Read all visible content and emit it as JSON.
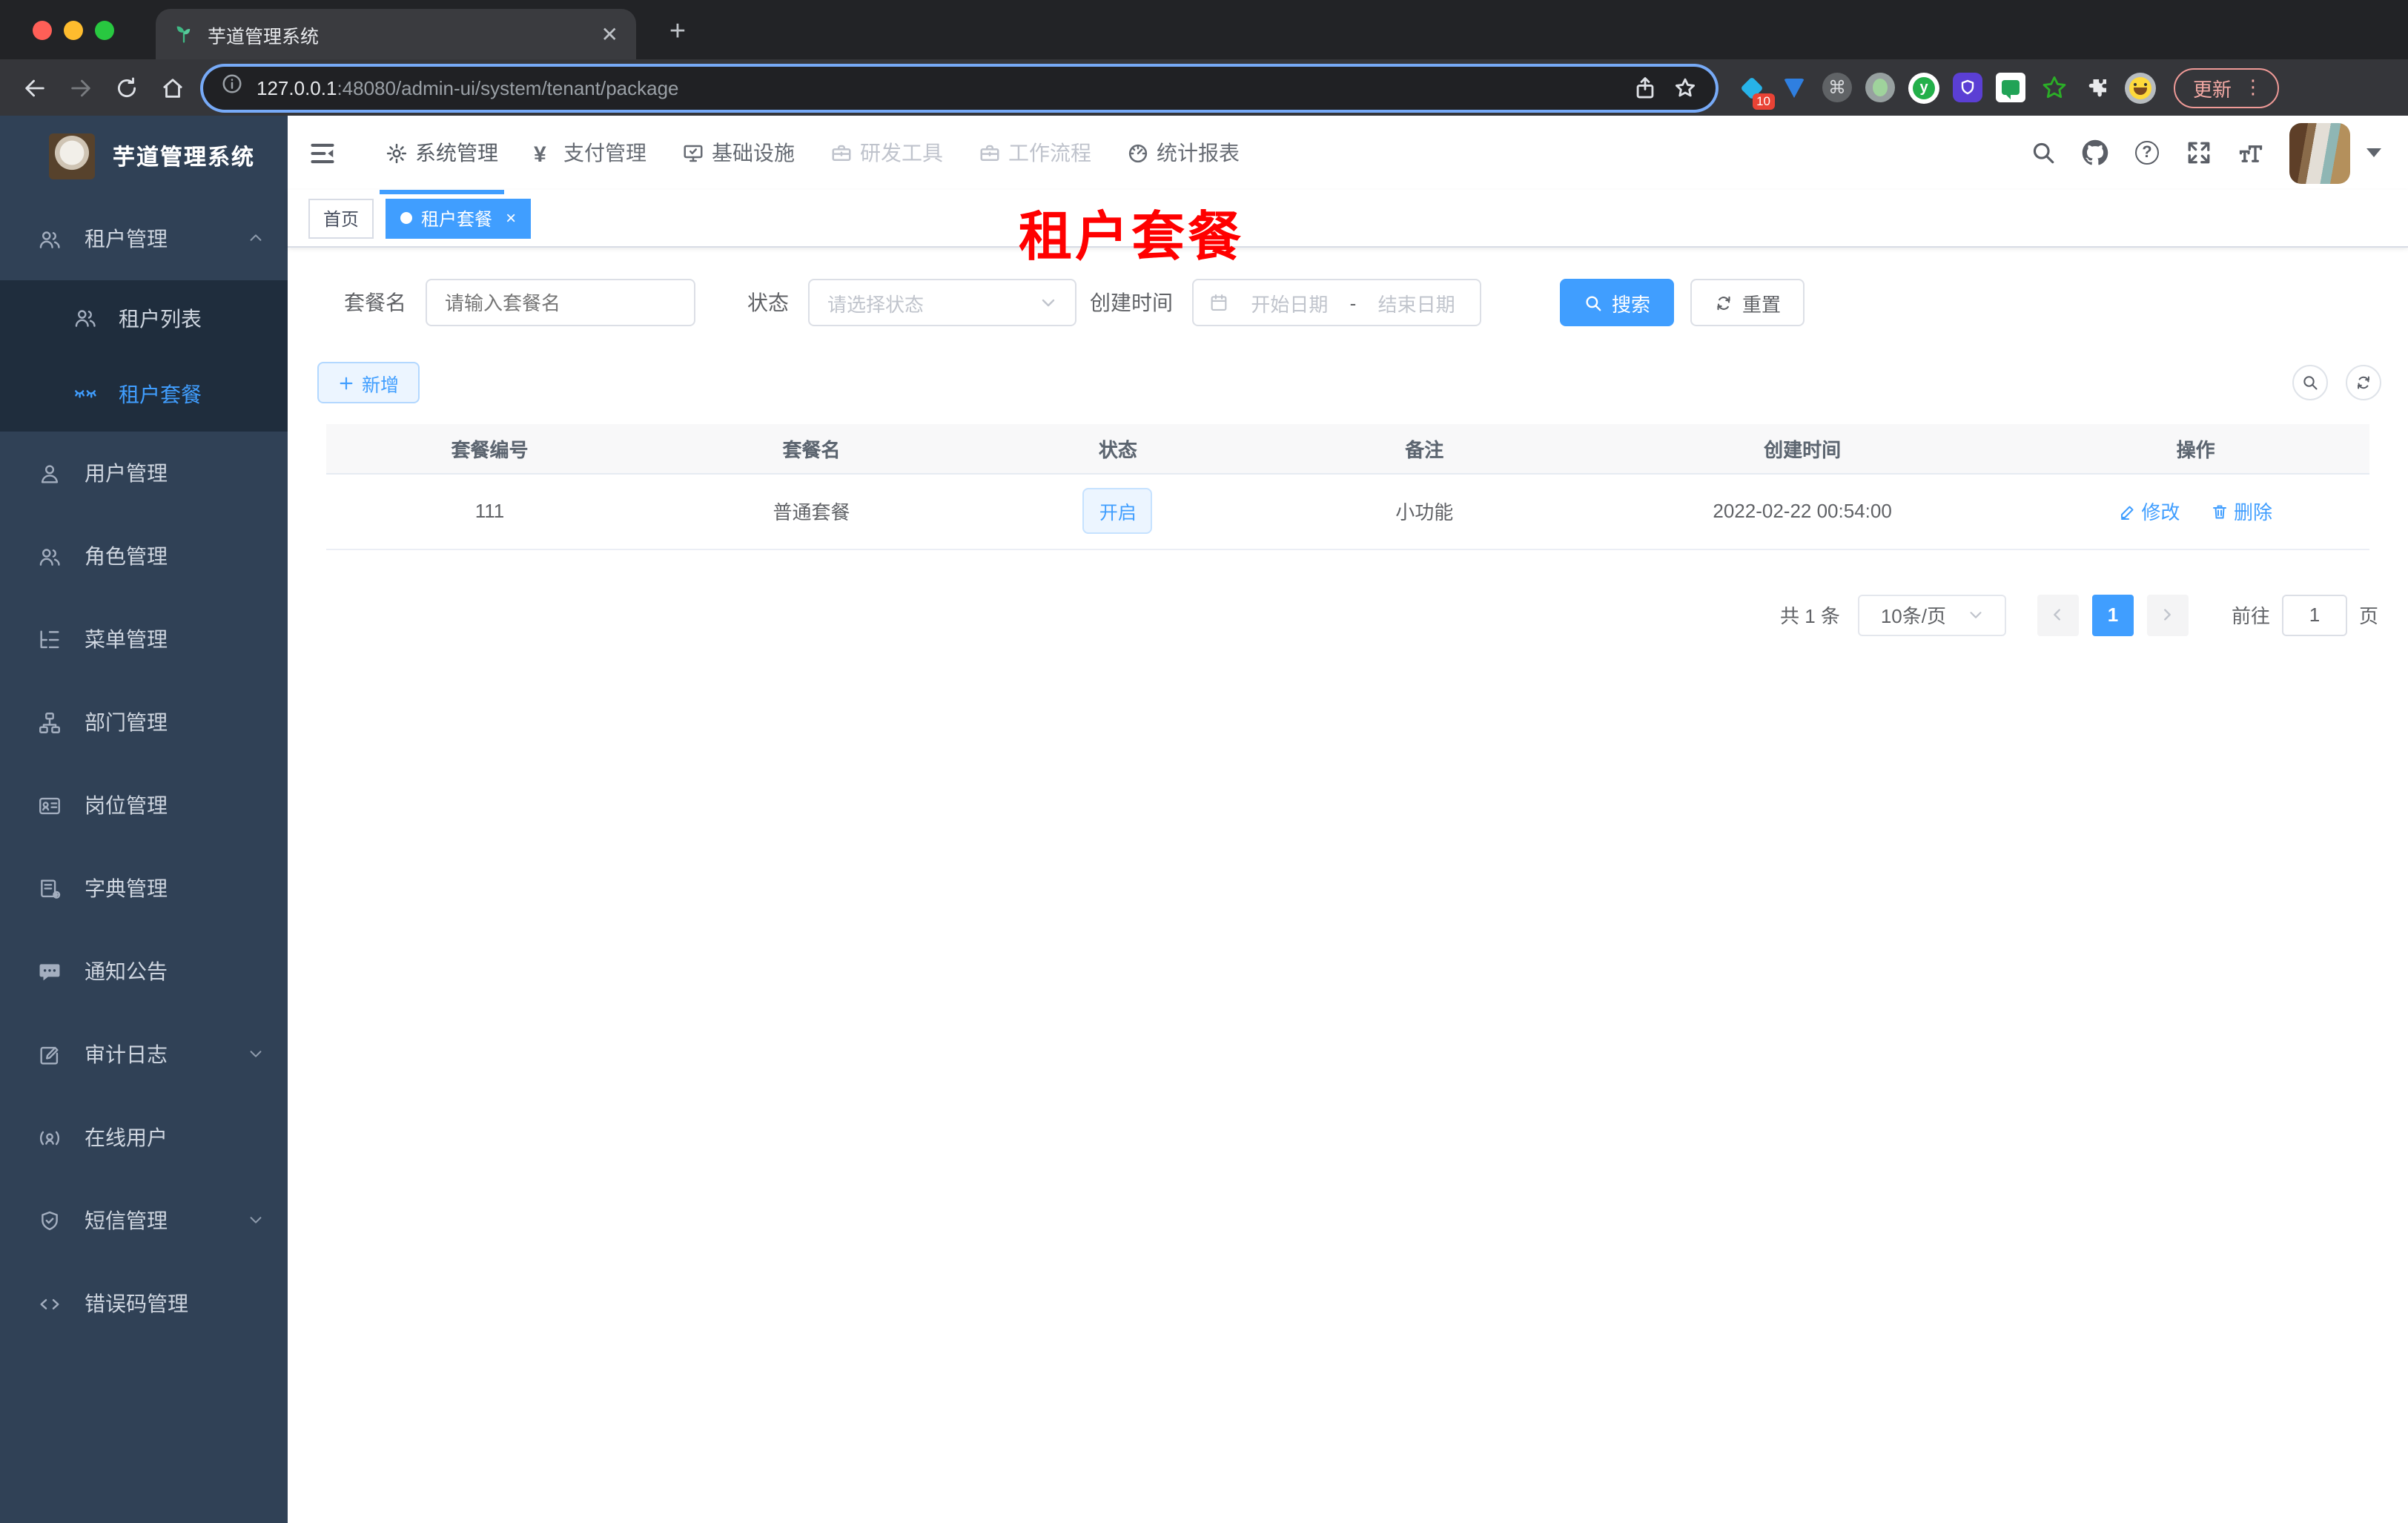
{
  "browser": {
    "tab_title": "芋道管理系统",
    "tab_close_glyph": "✕",
    "new_tab_glyph": "+",
    "url_host": "127.0.0.1",
    "url_path": ":48080/admin-ui/system/tenant/package",
    "ext_badge": "10",
    "command_glyph": "⌘",
    "ext_y_letter": "y",
    "update_label": "更新",
    "menu_dots_glyph": "⋮"
  },
  "sidebar": {
    "logo_title": "芋道管理系统",
    "tenant_group": {
      "label": "租户管理"
    },
    "tenant_children": [
      {
        "label": "租户列表"
      },
      {
        "label": "租户套餐"
      }
    ],
    "items": [
      {
        "label": "用户管理"
      },
      {
        "label": "角色管理"
      },
      {
        "label": "菜单管理"
      },
      {
        "label": "部门管理"
      },
      {
        "label": "岗位管理"
      },
      {
        "label": "字典管理"
      },
      {
        "label": "通知公告"
      },
      {
        "label": "审计日志"
      },
      {
        "label": "在线用户"
      },
      {
        "label": "短信管理"
      },
      {
        "label": "错误码管理"
      }
    ]
  },
  "topnav": {
    "items": [
      {
        "label": "系统管理"
      },
      {
        "label": "支付管理"
      },
      {
        "label": "基础设施"
      },
      {
        "label": "研发工具"
      },
      {
        "label": "工作流程"
      },
      {
        "label": "统计报表"
      }
    ],
    "yen_glyph": "¥",
    "help_glyph": "?"
  },
  "tags": {
    "home": "首页",
    "active": "租户套餐",
    "close_glyph": "×"
  },
  "page_title": "租户套餐",
  "filters": {
    "name_label": "套餐名",
    "name_placeholder": "请输入套餐名",
    "status_label": "状态",
    "status_placeholder": "请选择状态",
    "time_label": "创建时间",
    "start_placeholder": "开始日期",
    "range_separator": "-",
    "end_placeholder": "结束日期",
    "search_label": "搜索",
    "reset_label": "重置"
  },
  "toolbar": {
    "add_label": "新增"
  },
  "table": {
    "headers": [
      "套餐编号",
      "套餐名",
      "状态",
      "备注",
      "创建时间",
      "操作"
    ],
    "rows": [
      {
        "id": "111",
        "name": "普通套餐",
        "status": "开启",
        "remark": "小功能",
        "created": "2022-02-22 00:54:00",
        "edit_label": "修改",
        "delete_label": "删除"
      }
    ]
  },
  "pagination": {
    "total": "共 1 条",
    "page_size": "10条/页",
    "current_page": "1",
    "goto_label": "前往",
    "goto_value": "1",
    "page_unit": "页"
  }
}
